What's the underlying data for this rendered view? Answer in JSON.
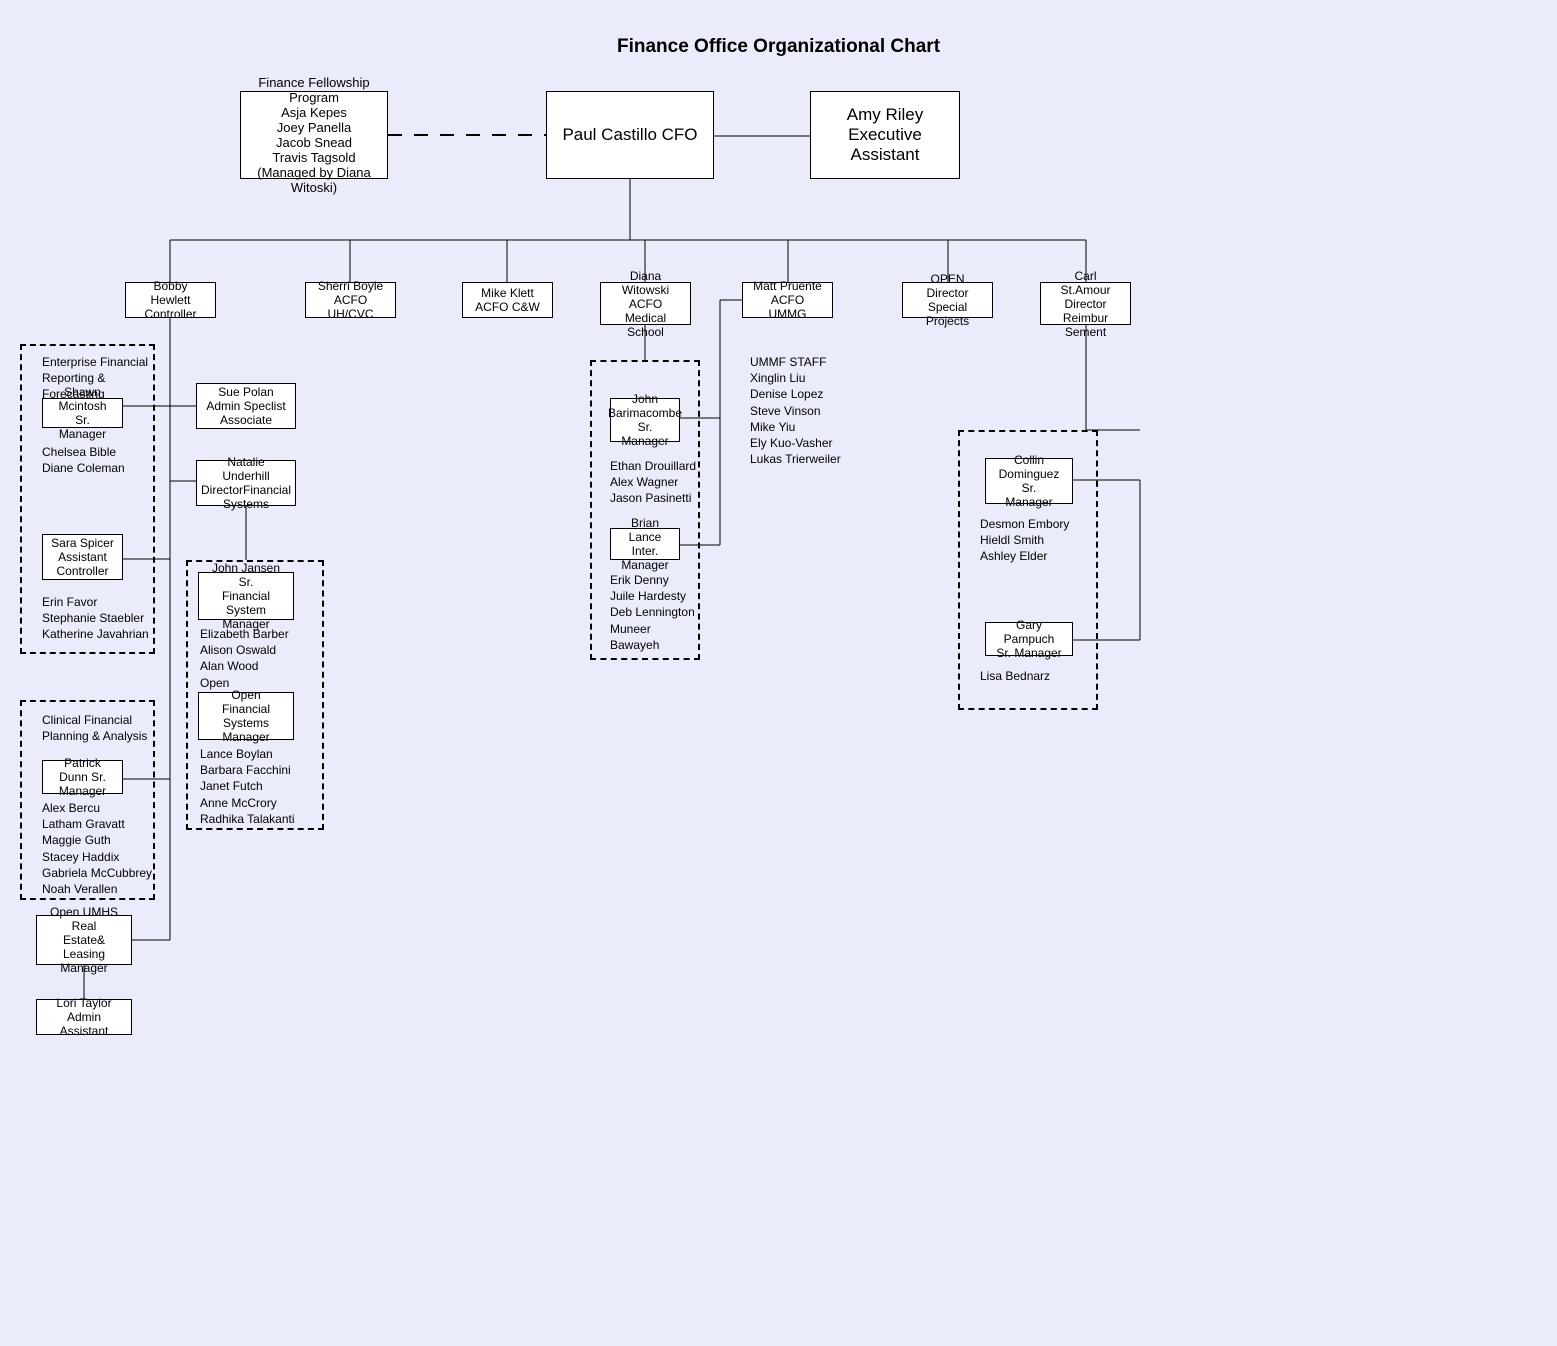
{
  "chart_data": {
    "type": "org-chart",
    "title": "Finance Office Organizational Chart",
    "root": {
      "name": "Paul Castillo",
      "role": "CFO",
      "side_boxes": [
        {
          "title": "Finance Fellowship Program",
          "people": [
            "Asja Kepes",
            "Joey Panella",
            "Jacob Snead",
            "Travis Tagsold"
          ],
          "note": "(Managed by Diana Witoski)",
          "relation": "dotted"
        },
        {
          "name": "Amy Riley",
          "role": "Executive Assistant",
          "relation": "solid"
        }
      ],
      "children": [
        {
          "name": "Bobby Hewlett",
          "role": "Controller",
          "side_boxes": [
            {
              "name": "Sue Polan",
              "role": "Admin Speclist Associate"
            },
            {
              "name": "Natalie Underhill",
              "role": "DirectorFinancial Systems",
              "children": [
                {
                  "name": "John Jansen",
                  "role": "Sr. Financial System Manager",
                  "staff": [
                    "Elizabeth Barber",
                    "Alison Oswald",
                    "Alan Wood",
                    "Open"
                  ]
                },
                {
                  "role": "Open Financial Systems Manager",
                  "staff": [
                    "Lance Boylan",
                    "Barbara Facchini",
                    "Janet Futch",
                    "Anne McCrory",
                    "Radhika Talakanti"
                  ]
                }
              ]
            }
          ],
          "groups": [
            {
              "title": "Enterprise Financial Reporting & Forecasting",
              "managers": [
                {
                  "name": "Shawn Mcintosh",
                  "role": "Sr. Manager",
                  "staff": [
                    "Chelsea Bible",
                    "Diane Coleman"
                  ]
                },
                {
                  "name": "Sara Spicer",
                  "role": "Assistant Controller",
                  "staff": [
                    "Erin Favor",
                    "Stephanie Staebler",
                    "Katherine Javahrian"
                  ]
                }
              ]
            },
            {
              "title": "Clinical Financial Planning & Analysis",
              "managers": [
                {
                  "name": "Patrick Dunn",
                  "role": "Sr. Manager",
                  "staff": [
                    "Alex Bercu",
                    "Latham Gravatt",
                    "Maggie Guth",
                    "Stacey Haddix",
                    "Gabriela McCubbrey",
                    "Noah Verallen"
                  ]
                }
              ]
            }
          ],
          "children": [
            {
              "role": "Open UMHS Real Estate& Leasing Manager",
              "children": [
                {
                  "name": "Lori Taylor",
                  "role": "Admin Assistant"
                }
              ]
            }
          ]
        },
        {
          "name": "Sherri Boyle",
          "role": "ACFO UH/CVC"
        },
        {
          "name": "Mike Klett",
          "role": "ACFO C&W"
        },
        {
          "name": "Diana Witowski",
          "role": "ACFO Medical School",
          "groups": [
            {
              "managers": [
                {
                  "name": "John Barimacombe",
                  "role": "Sr. Manager",
                  "staff": [
                    "Ethan Drouillard",
                    "Alex Wagner",
                    "Jason Pasinetti"
                  ]
                },
                {
                  "name": "Brian Lance",
                  "role": "Inter. Manager",
                  "staff": [
                    "Erik Denny",
                    "Juile Hardesty",
                    "Deb Lennington",
                    "Muneer Bawayeh"
                  ]
                }
              ]
            }
          ]
        },
        {
          "name": "Matt Pruente",
          "role": "ACFO UMMG",
          "staff_title": "UMMF STAFF",
          "staff": [
            "Xinglin Liu",
            "Denise Lopez",
            "Steve Vinson",
            "Mike Yiu",
            "Ely Kuo-Vasher",
            "Lukas Trierweiler"
          ]
        },
        {
          "role": "OPEN Director Special Projects"
        },
        {
          "name": "Carl St.Amour",
          "role": "Director Reimbur Sement",
          "groups": [
            {
              "managers": [
                {
                  "name": "Collin Dominguez",
                  "role": "Sr. Manager",
                  "staff": [
                    "Desmon Embory",
                    "Hieldl Smith",
                    "Ashley Elder"
                  ]
                },
                {
                  "name": "Gary Pampuch",
                  "role": "Sr. Manager",
                  "staff": [
                    "Lisa Bednarz"
                  ]
                }
              ]
            }
          ]
        }
      ]
    }
  },
  "title": "Finance Office Organizational Chart",
  "top": {
    "cfo_name": "Paul Castillo CFO",
    "assistant_name": "Amy Riley",
    "assistant_role": "Executive Assistant",
    "fellowship_l1": "Finance Fellowship Program",
    "fellowship_l2": "Asja Kepes",
    "fellowship_l3": "Joey Panella",
    "fellowship_l4": "Jacob Snead",
    "fellowship_l5": "Travis Tagsold",
    "fellowship_l6": "(Managed by Diana Witoski)"
  },
  "row2": {
    "b1_l1": "Bobby Hewlett",
    "b1_l2": "Controller",
    "b2_l1": "Sherri Boyle",
    "b2_l2": "ACFO UH/CVC",
    "b3_l1": "Mike Klett",
    "b3_l2": "ACFO C&W",
    "b4_l1": "Diana Witowski",
    "b4_l2": "ACFO Medical",
    "b4_l3": "School",
    "b5_l1": "Matt Pruente",
    "b5_l2": "ACFO UMMG",
    "b6_l1": "OPEN Director",
    "b6_l2": "Special Projects",
    "b7_l1": "Carl St.Amour",
    "b7_l2": "Director",
    "b7_l3": "Reimbur Sement"
  },
  "controller": {
    "efrf_title_l1": "Enterprise Financial",
    "efrf_title_l2": "Reporting &",
    "efrf_title_l3": "Forecasting",
    "shawn_l1": "Shawn Mcintosh Sr.",
    "shawn_l2": "Manager",
    "shawn_staff_l1": "Chelsea Bible",
    "shawn_staff_l2": "Diane Coleman",
    "sara_l1": "Sara Spicer",
    "sara_l2": "Assistant",
    "sara_l3": "Controller",
    "sara_staff_l1": "Erin Favor",
    "sara_staff_l2": "Stephanie Staebler",
    "sara_staff_l3": "Katherine Javahrian",
    "sue_l1": "Sue Polan",
    "sue_l2": "Admin Speclist",
    "sue_l3": "Associate",
    "nat_l1": "Natalie Underhill",
    "nat_l2": "DirectorFinancial",
    "nat_l3": "Systems",
    "jj_l1": "John Jansen Sr.",
    "jj_l2": "Financial System",
    "jj_l3": "Manager",
    "jj_staff_l1": "Elizabeth Barber",
    "jj_staff_l2": "Alison Oswald",
    "jj_staff_l3": "Alan Wood",
    "jj_staff_l4": "Open",
    "ofs_l1": "Open Financial",
    "ofs_l2": "Systems",
    "ofs_l3": "Manager",
    "ofs_staff_l1": "Lance Boylan",
    "ofs_staff_l2": "Barbara Facchini",
    "ofs_staff_l3": "Janet Futch",
    "ofs_staff_l4": "Anne McCrory",
    "ofs_staff_l5": "Radhika Talakanti",
    "cfpa_title_l1": "Clinical Financial",
    "cfpa_title_l2": "Planning & Analysis",
    "pd_l1": "Patrick Dunn Sr.",
    "pd_l2": "Manager",
    "pd_staff_l1": "Alex Bercu",
    "pd_staff_l2": "Latham Gravatt",
    "pd_staff_l3": "Maggie Guth",
    "pd_staff_l4": "Stacey Haddix",
    "pd_staff_l5": "Gabriela McCubbrey",
    "pd_staff_l6": "Noah Verallen",
    "re_l1": "Open UMHS Real",
    "re_l2": "Estate& Leasing",
    "re_l3": "Manager",
    "lori_l1": "Lori Taylor",
    "lori_l2": "Admin Assistant"
  },
  "medical": {
    "jb_l1": "John",
    "jb_l2": "Barimacombe",
    "jb_l3": "Sr. Manager",
    "jb_staff_l1": "Ethan Drouillard",
    "jb_staff_l2": "Alex Wagner",
    "jb_staff_l3": "Jason Pasinetti",
    "bl_l1": "Brian Lance",
    "bl_l2": "Inter. Manager",
    "bl_staff_l1": "Erik Denny",
    "bl_staff_l2": "Juile Hardesty",
    "bl_staff_l3": "Deb Lennington",
    "bl_staff_l4": "Muneer",
    "bl_staff_l5": "Bawayeh"
  },
  "ummg": {
    "title": "UMMF STAFF",
    "s1": "Xinglin Liu",
    "s2": "Denise Lopez",
    "s3": "Steve Vinson",
    "s4": "Mike Yiu",
    "s5": "Ely Kuo-Vasher",
    "s6": "Lukas Trierweiler"
  },
  "reimb": {
    "cd_l1": "Collin",
    "cd_l2": "Dominguez Sr.",
    "cd_l3": "Manager",
    "cd_staff_l1": "Desmon Embory",
    "cd_staff_l2": "Hieldl Smith",
    "cd_staff_l3": "Ashley Elder",
    "gp_l1": "Gary Pampuch",
    "gp_l2": "Sr. Manager",
    "gp_staff_l1": "Lisa Bednarz"
  }
}
